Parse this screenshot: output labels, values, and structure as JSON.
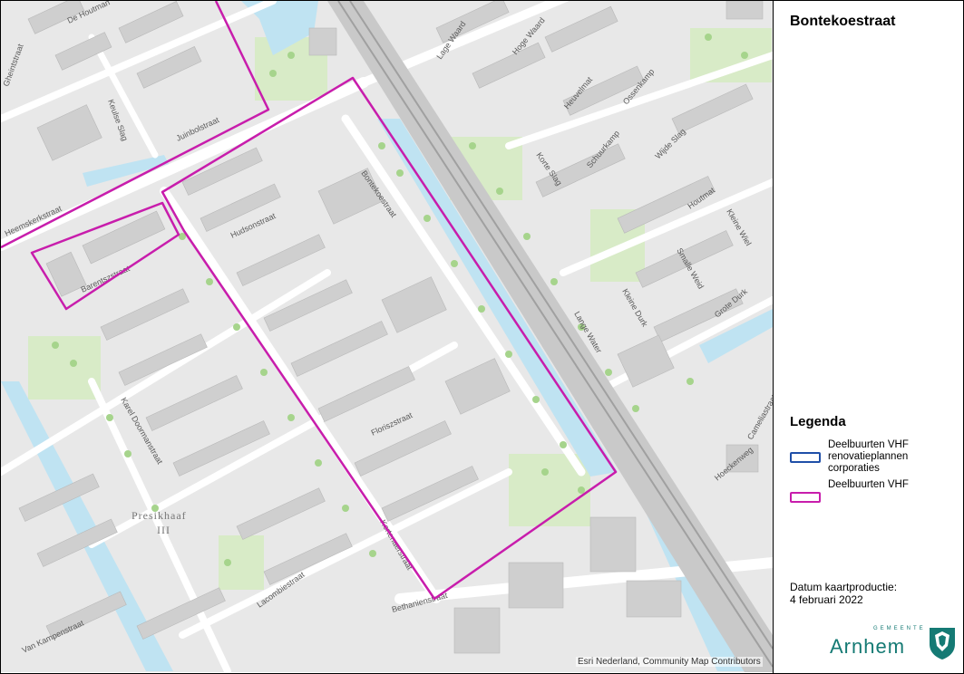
{
  "map": {
    "title": "Bontekoestraat",
    "credits": "Esri Nederland, Community Map Contributors",
    "district_label_line1": "Presikhaaf",
    "district_label_line2": "III",
    "street_labels": [
      "De Houtman",
      "Gheintstraat",
      "Keulse Slag",
      "Juinbolstraat",
      "Lage Waard",
      "Hoge Waard",
      "Heuvelmat",
      "Ossenkamp",
      "Schuurkamp",
      "Wijde Slag",
      "Korte Slag",
      "Hudsonstraat",
      "Bontekoestraat",
      "Barentszstraat",
      "Heemskerkstraat",
      "Houtmat",
      "Kleine Wiel",
      "Smalle Weid",
      "Grote Durk",
      "Kleine Durk",
      "Lange Water",
      "Karel Doormanstraat",
      "Floriszstraat",
      "Kortenaerstraat",
      "Lacombiestraat",
      "Van Kampenstraat",
      "Bethanienstraat",
      "Hoeckenweg",
      "Cameliastraat"
    ],
    "colors": {
      "magenta_boundary": "#c81dac",
      "blue_boundary": "#1f4fa8",
      "road": "#ffffff",
      "background": "#e8e8e8",
      "building": "#cfcfcf",
      "water": "#bfe3f2",
      "green": "#d8ebc7",
      "tree": "#a6d48c",
      "rail": "#b5b5b5"
    }
  },
  "legend": {
    "heading": "Legenda",
    "items": [
      {
        "label": "Deelbuurten VHF renovatieplannen corporaties",
        "color": "#1f4fa8"
      },
      {
        "label": "Deelbuurten VHF",
        "color": "#c81dac"
      }
    ]
  },
  "footer": {
    "date_label": "Datum kaartproductie:",
    "date_value": "4 februari 2022"
  },
  "logo": {
    "small_text": "GEMEENTE",
    "name": "Arnhem"
  }
}
